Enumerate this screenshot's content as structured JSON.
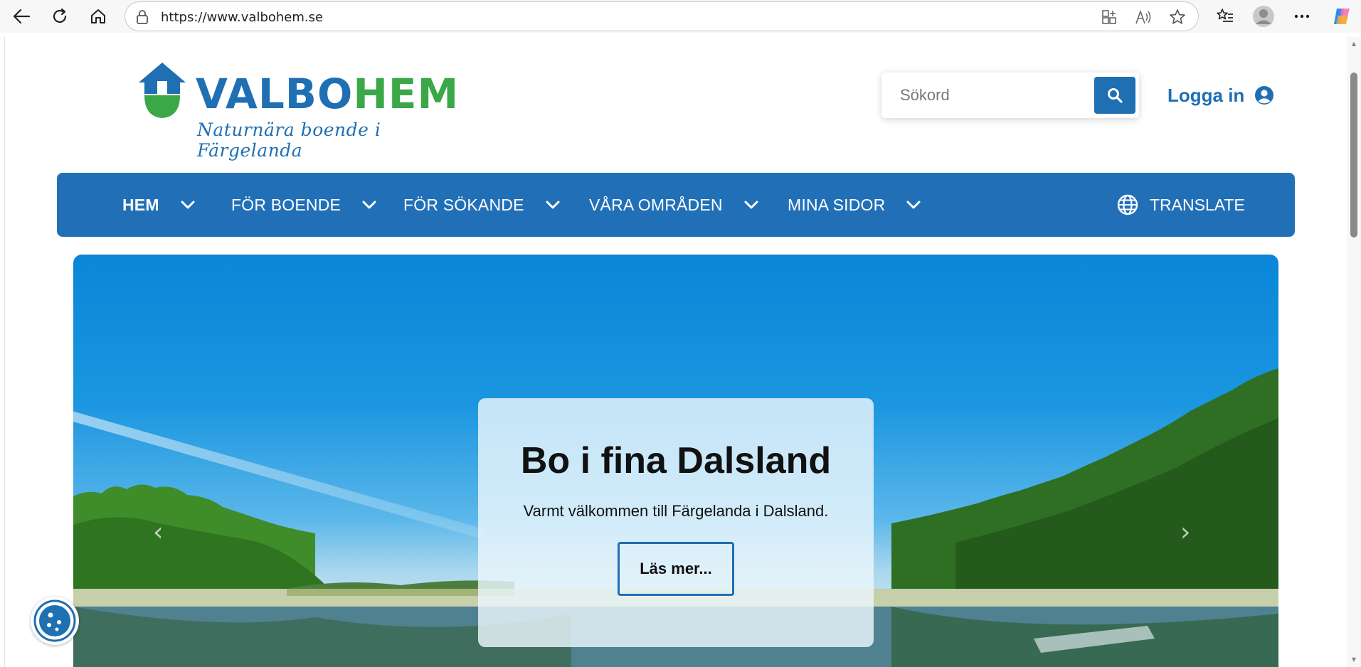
{
  "browser": {
    "url": "https://www.valbohem.se",
    "icons": [
      "back-icon",
      "refresh-icon",
      "home-icon",
      "lock-icon",
      "app-grid-icon",
      "read-aloud-icon",
      "favorite-star-icon",
      "favorites-list-icon",
      "profile-icon",
      "more-icon",
      "copilot-icon"
    ]
  },
  "header": {
    "logo_word_part1": "VALBO",
    "logo_word_part2": "HEM",
    "logo_tagline": "Naturnära boende i Färgelanda",
    "search_placeholder": "Sökord",
    "login_label": "Logga in"
  },
  "nav": {
    "items": [
      {
        "label": "HEM"
      },
      {
        "label": "FÖR BOENDE"
      },
      {
        "label": "FÖR SÖKANDE"
      },
      {
        "label": "VÅRA OMRÅDEN"
      },
      {
        "label": "MINA SIDOR"
      }
    ],
    "translate_label": "TRANSLATE"
  },
  "hero": {
    "title": "Bo i fina Dalsland",
    "subtitle": "Varmt välkommen till Färgelanda i Dalsland.",
    "button_label": "Läs mer..."
  },
  "colors": {
    "brand_blue": "#1f6fb3",
    "brand_green": "#3aa846",
    "nav_blue": "#2170b7"
  }
}
